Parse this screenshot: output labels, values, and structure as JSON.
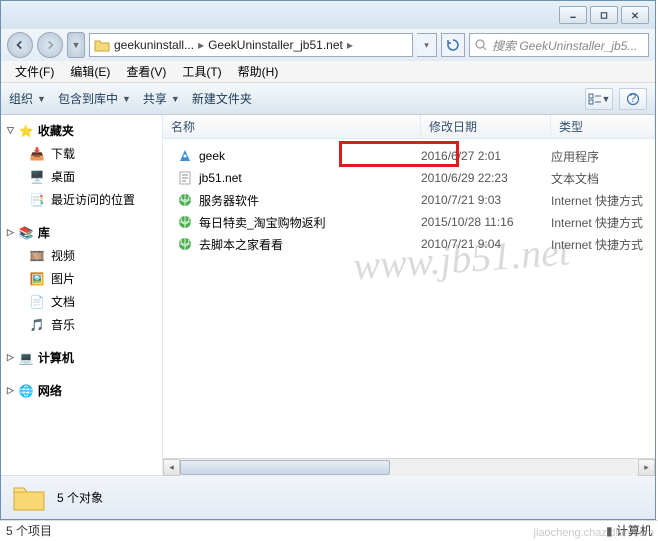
{
  "titlebar": {},
  "address": {
    "crumb1": "geekuninstall...",
    "crumb2": "GeekUninstaller_jb51.net"
  },
  "search": {
    "placeholder": "搜索 GeekUninstaller_jb5..."
  },
  "menu": {
    "file": "文件(F)",
    "edit": "编辑(E)",
    "view": "查看(V)",
    "tools": "工具(T)",
    "help": "帮助(H)"
  },
  "toolbar": {
    "organize": "组织",
    "include": "包含到库中",
    "share": "共享",
    "newfolder": "新建文件夹"
  },
  "nav": {
    "favorites": "收藏夹",
    "downloads": "下载",
    "desktop": "桌面",
    "recent": "最近访问的位置",
    "libraries": "库",
    "videos": "视频",
    "pictures": "图片",
    "documents": "文档",
    "music": "音乐",
    "computer": "计算机",
    "network": "网络"
  },
  "columns": {
    "name": "名称",
    "date": "修改日期",
    "type": "类型"
  },
  "files": [
    {
      "name": "geek",
      "date": "2016/6/27 2:01",
      "type": "应用程序",
      "icon": "app"
    },
    {
      "name": "jb51.net",
      "date": "2010/6/29 22:23",
      "type": "文本文档",
      "icon": "txt"
    },
    {
      "name": "服务器软件",
      "date": "2010/7/21 9:03",
      "type": "Internet 快捷方式",
      "icon": "web"
    },
    {
      "name": "每日特卖_淘宝购物返利",
      "date": "2015/10/28 11:16",
      "type": "Internet 快捷方式",
      "icon": "web"
    },
    {
      "name": "去脚本之家看看",
      "date": "2010/7/21 9:04",
      "type": "Internet 快捷方式",
      "icon": "web"
    }
  ],
  "preview": {
    "label": "5 个对象"
  },
  "status": {
    "left": "5 个项目",
    "right": "计算机"
  },
  "watermark": "www.jb51.net",
  "corner_wm": "jiaocheng.chazidian.com"
}
